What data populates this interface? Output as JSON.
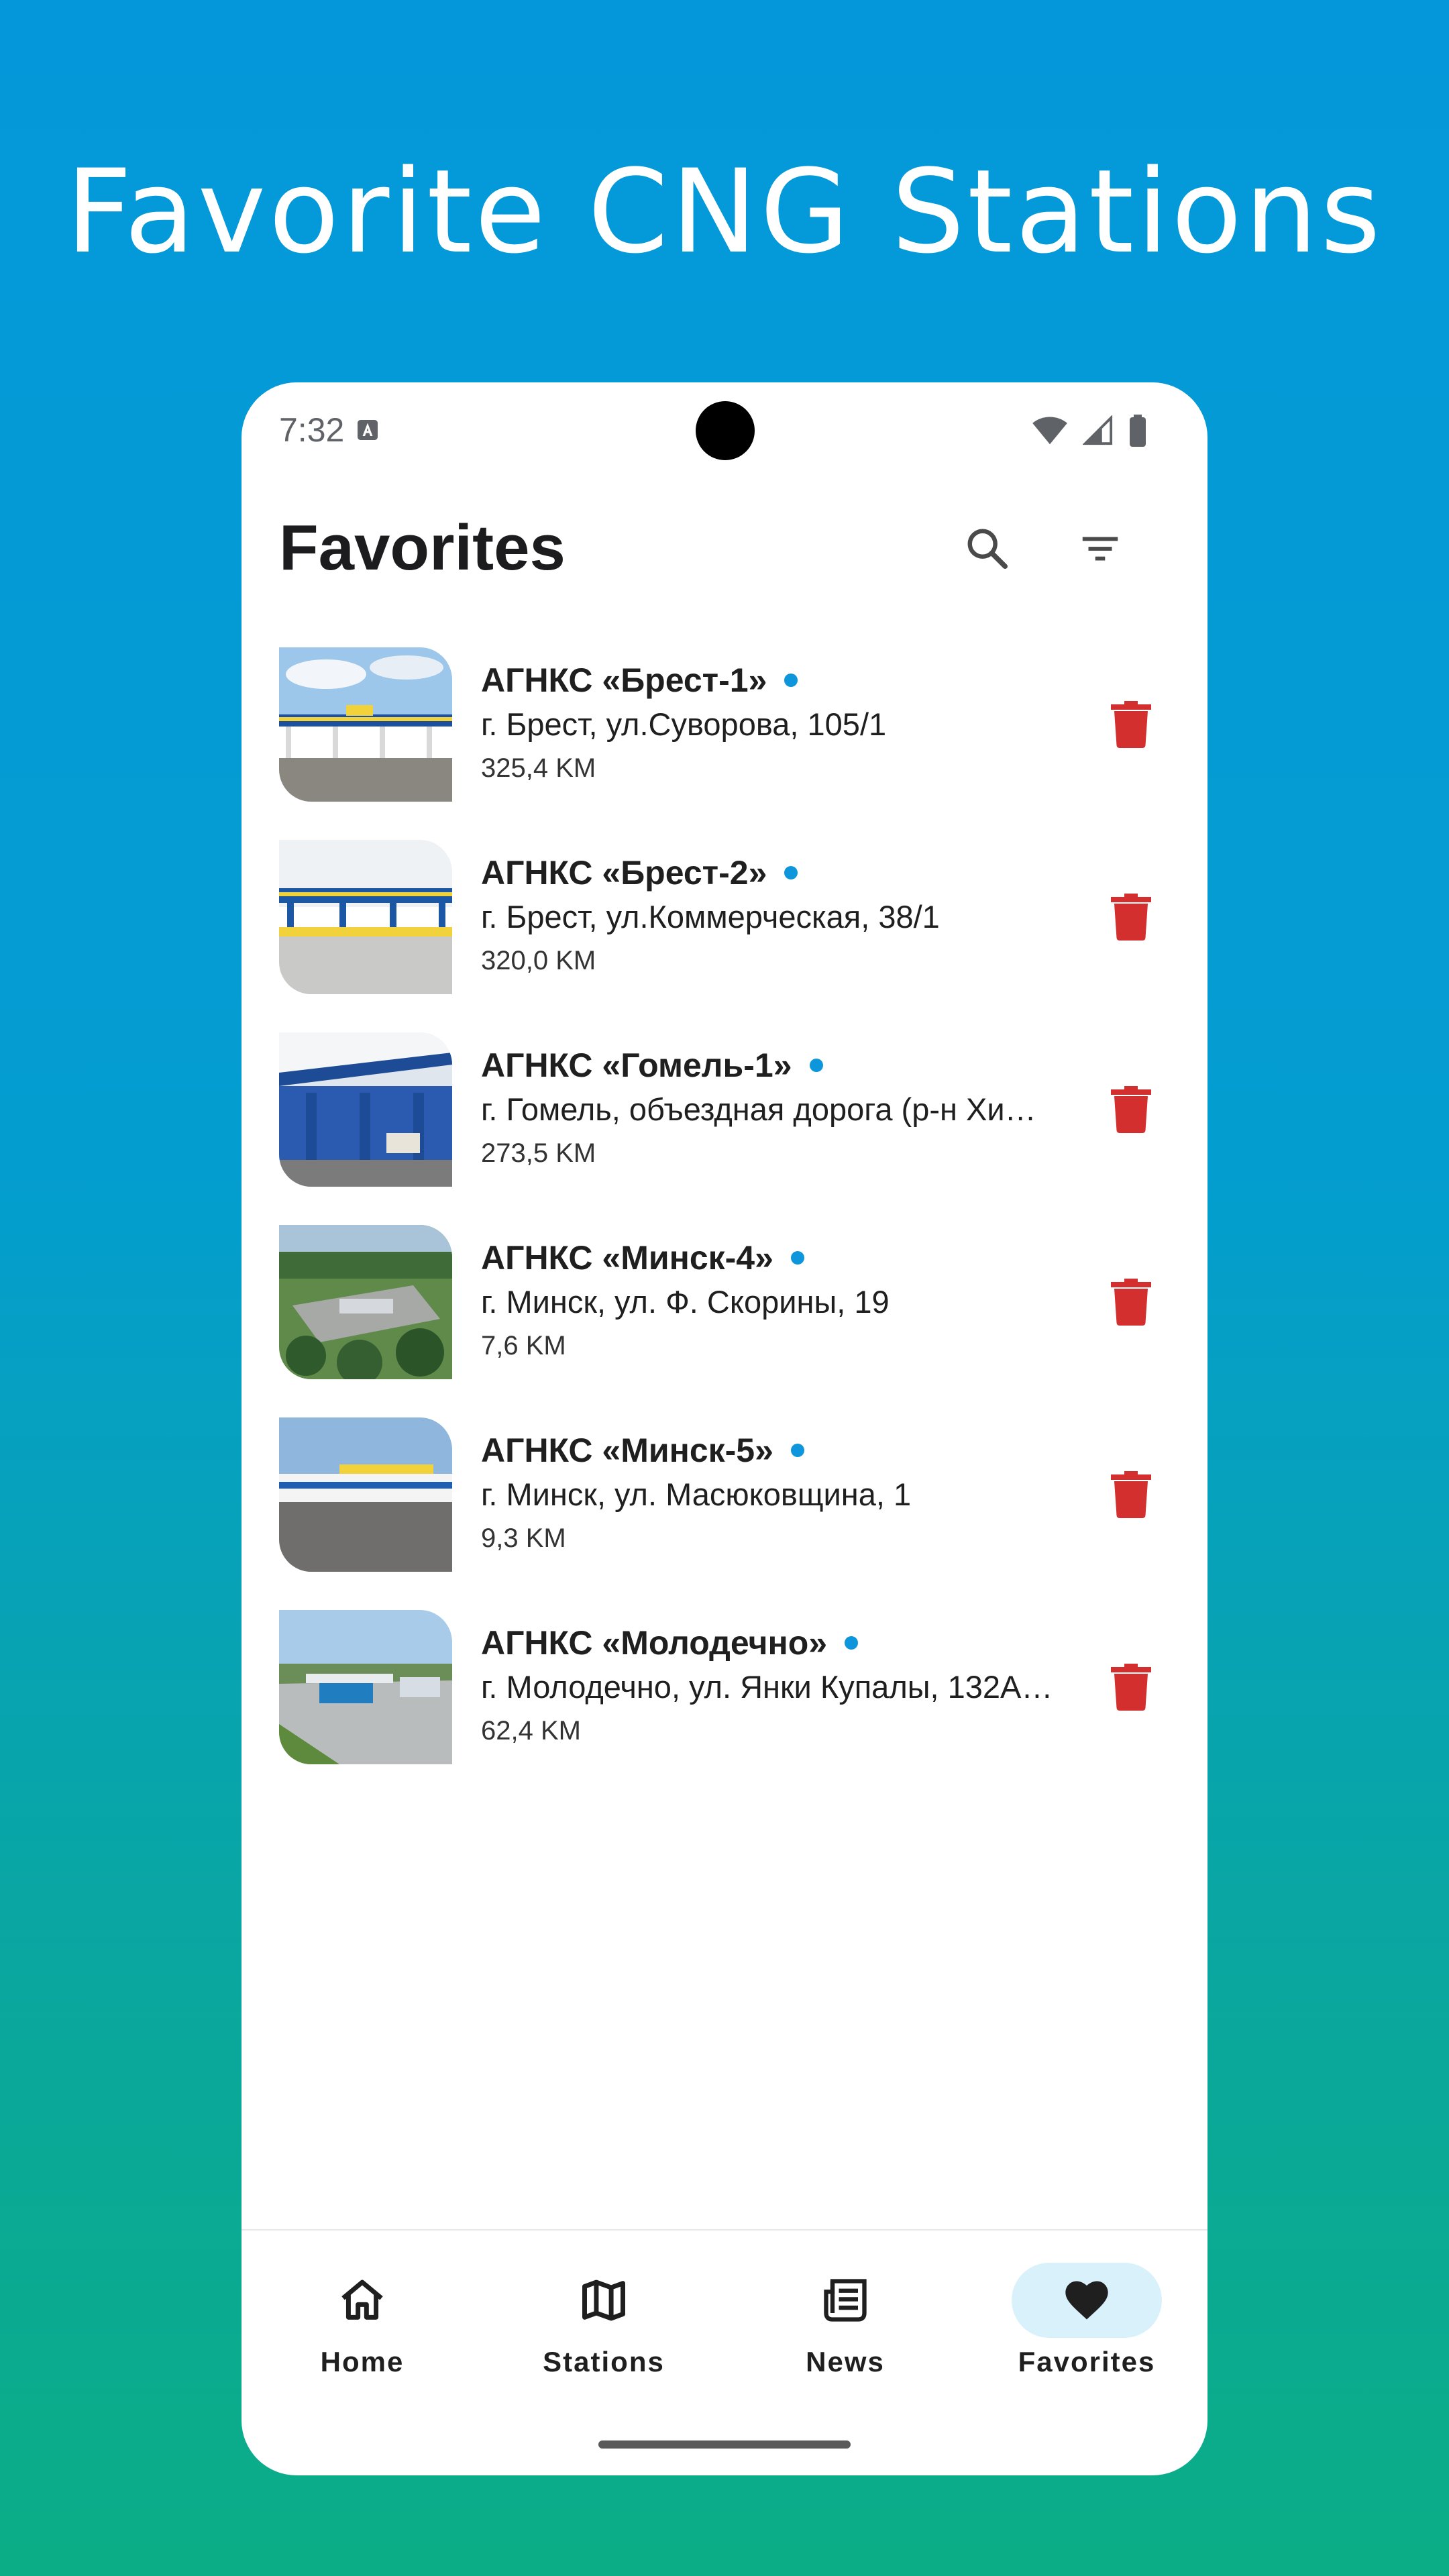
{
  "headline": "Favorite CNG Stations",
  "status_bar": {
    "time": "7:32",
    "icons": [
      "notification-a-icon",
      "wifi-icon",
      "signal-icon",
      "battery-icon"
    ]
  },
  "app_bar": {
    "title": "Favorites",
    "actions": [
      "search-icon",
      "filter-icon"
    ]
  },
  "stations": [
    {
      "name": "АГНКС «Брест-1»",
      "address": "г. Брест, ул.Суворова, 105/1",
      "distance": "325,4 KM"
    },
    {
      "name": "АГНКС «Брест-2»",
      "address": "г. Брест, ул.Коммерческая, 38/1",
      "distance": "320,0 KM"
    },
    {
      "name": "АГНКС «Гомель-1»",
      "address": "г. Гомель, объездная дорога (р-н Хи…",
      "distance": "273,5 KM"
    },
    {
      "name": "АГНКС «Минск-4»",
      "address": "г. Минск, ул. Ф. Скорины, 19",
      "distance": "7,6 KM"
    },
    {
      "name": "АГНКС «Минск-5»",
      "address": "г. Минск, ул. Масюковщина, 1",
      "distance": "9,3 KM"
    },
    {
      "name": "АГНКС «Молодечно»",
      "address": "г. Молодечно, ул. Янки Купалы, 132А…",
      "distance": "62,4 KM"
    }
  ],
  "nav": [
    {
      "label": "Home",
      "icon": "home-icon",
      "active": false
    },
    {
      "label": "Stations",
      "icon": "map-icon",
      "active": false
    },
    {
      "label": "News",
      "icon": "news-icon",
      "active": false
    },
    {
      "label": "Favorites",
      "icon": "heart-icon",
      "active": true
    }
  ],
  "colors": {
    "accent_dot": "#0d96db",
    "delete": "#d32f2f",
    "active_pill": "#d9f1fb"
  }
}
